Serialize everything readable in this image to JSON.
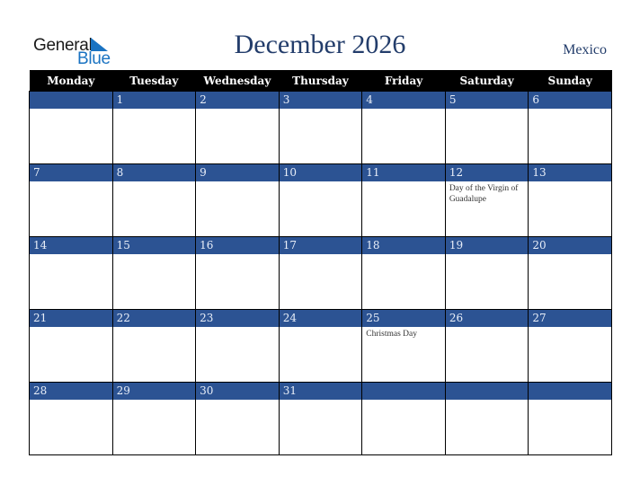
{
  "logo": {
    "word1": "General",
    "word2": "Blue"
  },
  "header": {
    "title": "December 2026",
    "country": "Mexico"
  },
  "weekdays": [
    "Monday",
    "Tuesday",
    "Wednesday",
    "Thursday",
    "Friday",
    "Saturday",
    "Sunday"
  ],
  "weeks": [
    [
      {
        "day": "",
        "event": ""
      },
      {
        "day": "1",
        "event": ""
      },
      {
        "day": "2",
        "event": ""
      },
      {
        "day": "3",
        "event": ""
      },
      {
        "day": "4",
        "event": ""
      },
      {
        "day": "5",
        "event": ""
      },
      {
        "day": "6",
        "event": ""
      }
    ],
    [
      {
        "day": "7",
        "event": ""
      },
      {
        "day": "8",
        "event": ""
      },
      {
        "day": "9",
        "event": ""
      },
      {
        "day": "10",
        "event": ""
      },
      {
        "day": "11",
        "event": ""
      },
      {
        "day": "12",
        "event": "Day of the Virgin of Guadalupe"
      },
      {
        "day": "13",
        "event": ""
      }
    ],
    [
      {
        "day": "14",
        "event": ""
      },
      {
        "day": "15",
        "event": ""
      },
      {
        "day": "16",
        "event": ""
      },
      {
        "day": "17",
        "event": ""
      },
      {
        "day": "18",
        "event": ""
      },
      {
        "day": "19",
        "event": ""
      },
      {
        "day": "20",
        "event": ""
      }
    ],
    [
      {
        "day": "21",
        "event": ""
      },
      {
        "day": "22",
        "event": ""
      },
      {
        "day": "23",
        "event": ""
      },
      {
        "day": "24",
        "event": ""
      },
      {
        "day": "25",
        "event": "Christmas Day"
      },
      {
        "day": "26",
        "event": ""
      },
      {
        "day": "27",
        "event": ""
      }
    ],
    [
      {
        "day": "28",
        "event": ""
      },
      {
        "day": "29",
        "event": ""
      },
      {
        "day": "30",
        "event": ""
      },
      {
        "day": "31",
        "event": ""
      },
      {
        "day": "",
        "event": ""
      },
      {
        "day": "",
        "event": ""
      },
      {
        "day": "",
        "event": ""
      }
    ]
  ],
  "colors": {
    "band": "#2c5393",
    "title": "#233d6b",
    "logo_blue": "#1a73c2"
  }
}
